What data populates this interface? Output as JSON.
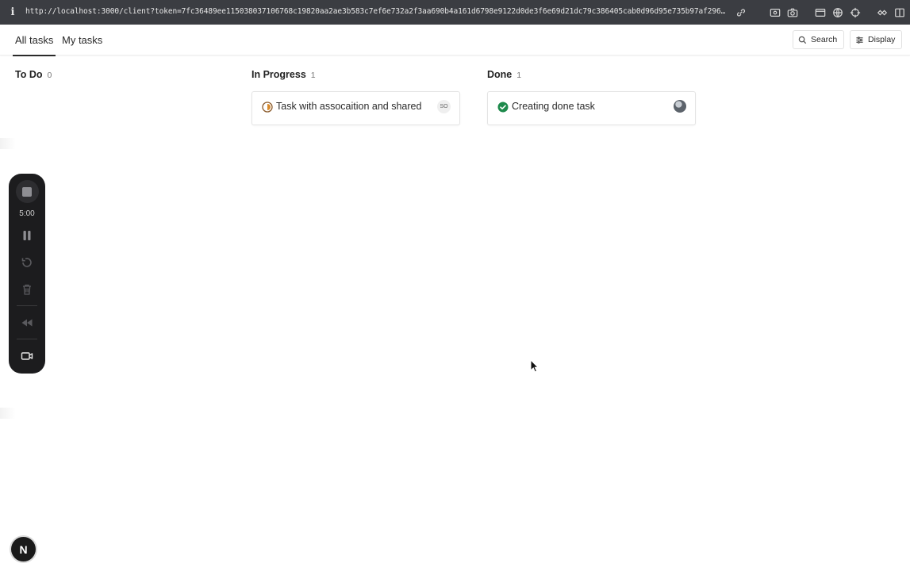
{
  "browser": {
    "info_glyph": "i",
    "url": "http://localhost:3000/client?token=7fc36489ee115038037106768c19820aa2ae3b583c7ef6e732a2f3aa690b4a161d6798e9122d0de3f6e69d21dc79c386405cab0d96d95e735b97af296e2217a951e841a2d7…",
    "icons": [
      "link-icon",
      "screen-record-icon",
      "camera-icon",
      "window-icon",
      "globe-icon",
      "crosshair-icon",
      "extensions-icon",
      "sidebar-icon"
    ]
  },
  "header": {
    "tabs": [
      {
        "label": "All tasks",
        "active": true
      },
      {
        "label": "My tasks",
        "active": false
      }
    ],
    "search_label": "Search",
    "display_label": "Display"
  },
  "board": {
    "columns": [
      {
        "title": "To Do",
        "count": "0",
        "cards": []
      },
      {
        "title": "In Progress",
        "count": "1",
        "cards": [
          {
            "title": "Task with assocaition and shared",
            "status_icon": "in-progress-icon",
            "assignee": "SO"
          }
        ]
      },
      {
        "title": "Done",
        "count": "1",
        "cards": [
          {
            "title": "Creating done task",
            "status_icon": "done-check-icon",
            "assignee": "avatar"
          }
        ]
      }
    ]
  },
  "recorder": {
    "time": "5:00",
    "icons": [
      "stop-icon",
      "pause-icon",
      "restart-icon",
      "trash-icon",
      "rewind-icon",
      "camera-icon"
    ]
  },
  "badge": {
    "letter": "N"
  },
  "colors": {
    "done_green": "#1e8a4c",
    "progress_orange": "#d98a2b",
    "recorder_bg": "#1c1c1e",
    "browser_bar": "#3b3d42"
  }
}
